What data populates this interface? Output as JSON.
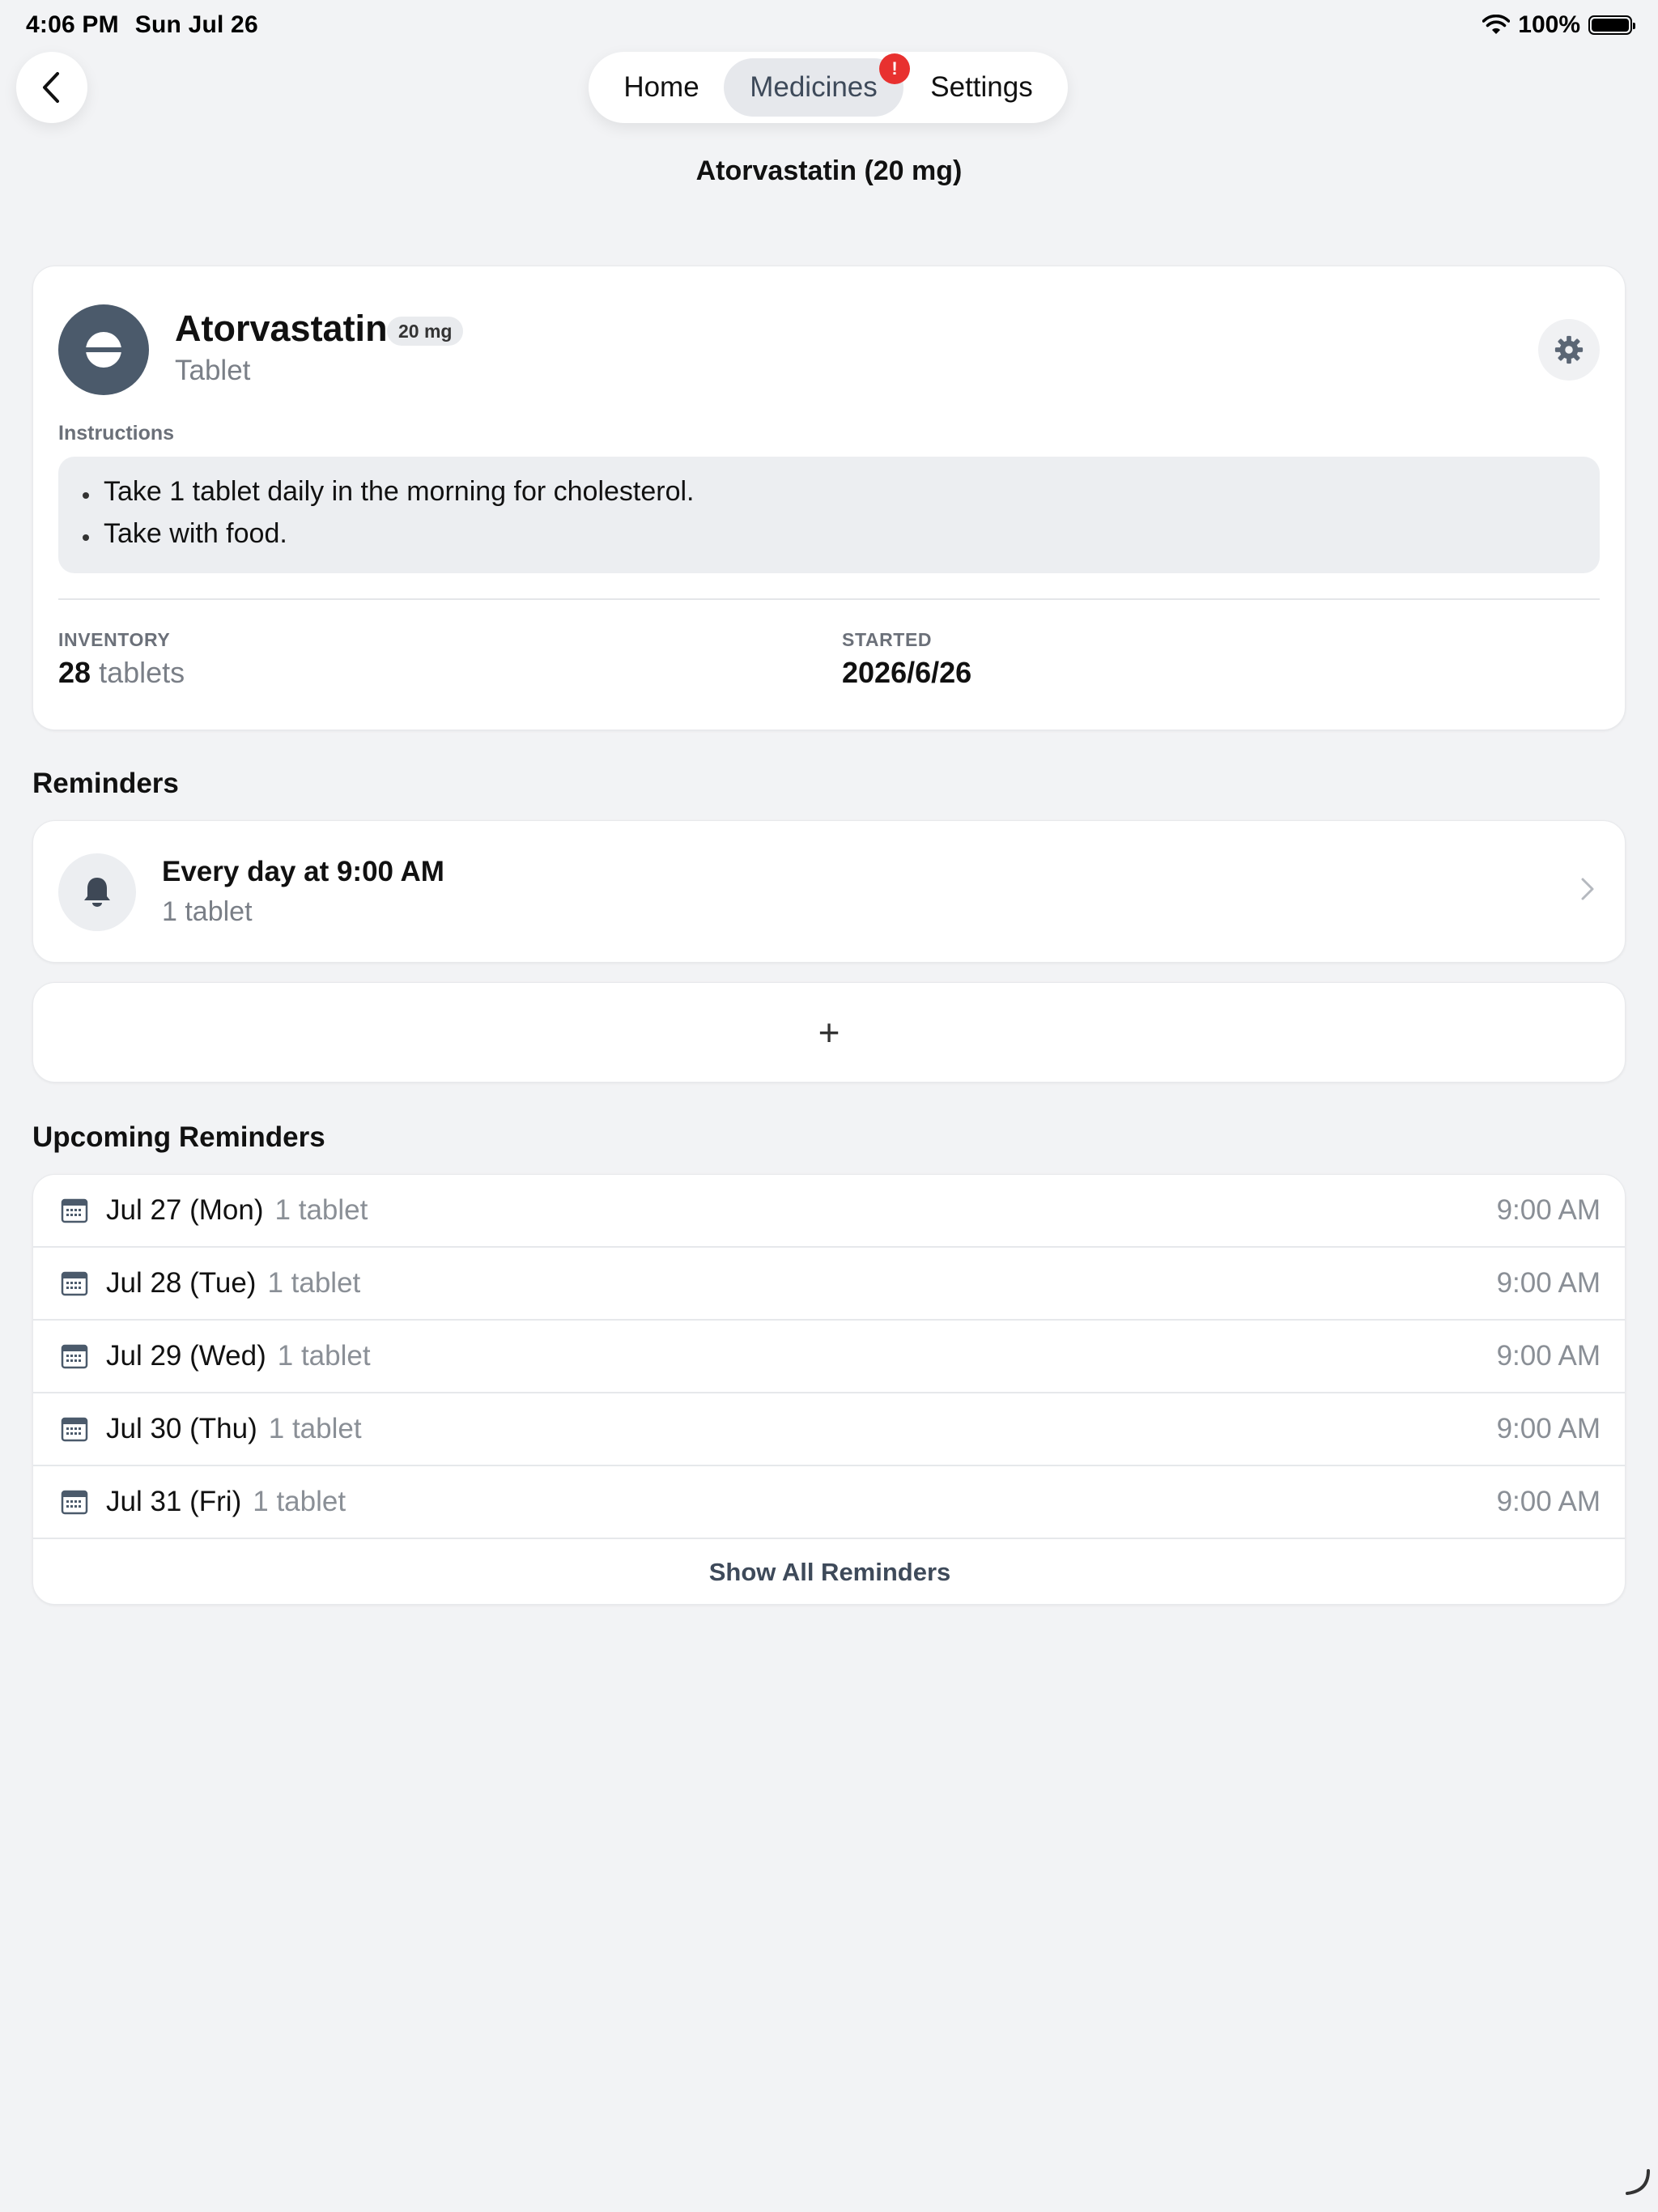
{
  "status_bar": {
    "time": "4:06 PM",
    "date": "Sun Jul 26",
    "battery": "100%"
  },
  "nav": {
    "tabs": [
      {
        "label": "Home"
      },
      {
        "label": "Medicines"
      },
      {
        "label": "Settings"
      }
    ],
    "active_tab": "Medicines",
    "alert_badge": "!"
  },
  "page": {
    "title": "Atorvastatin (20 mg)"
  },
  "medicine": {
    "name": "Atorvastatin",
    "dose": "20 mg",
    "form": "Tablet",
    "instructions_label": "Instructions",
    "instructions": [
      "Take 1 tablet daily in the morning for cholesterol.",
      "Take with food."
    ],
    "inventory_label": "INVENTORY",
    "inventory_count": "28",
    "inventory_unit": "tablets",
    "started_label": "STARTED",
    "started_value": "2026/6/26"
  },
  "reminders": {
    "heading": "Reminders",
    "items": [
      {
        "title": "Every day at 9:00 AM",
        "quantity": "1 tablet"
      }
    ],
    "add_label": "+"
  },
  "upcoming": {
    "heading": "Upcoming Reminders",
    "rows": [
      {
        "date": "Jul 27 (Mon)",
        "quantity": "1 tablet",
        "time": "9:00 AM"
      },
      {
        "date": "Jul 28 (Tue)",
        "quantity": "1 tablet",
        "time": "9:00 AM"
      },
      {
        "date": "Jul 29 (Wed)",
        "quantity": "1 tablet",
        "time": "9:00 AM"
      },
      {
        "date": "Jul 30 (Thu)",
        "quantity": "1 tablet",
        "time": "9:00 AM"
      },
      {
        "date": "Jul 31 (Fri)",
        "quantity": "1 tablet",
        "time": "9:00 AM"
      }
    ],
    "show_all_label": "Show All Reminders"
  },
  "colors": {
    "accent_slate": "#4b5a6b",
    "alert_red": "#e8312f",
    "background": "#f2f3f5"
  }
}
